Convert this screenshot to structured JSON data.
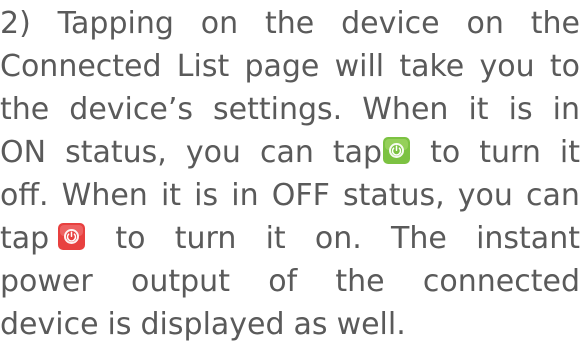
{
  "paragraph": {
    "line1": [
      "2)",
      "Tapping",
      "on",
      "the",
      "device",
      "on",
      "the"
    ],
    "line2": [
      "Connected",
      "List",
      "page",
      "will",
      "take",
      "you",
      "to"
    ],
    "line3": [
      "the",
      "device’s",
      "settings.",
      "When",
      "it",
      "is",
      "in"
    ],
    "line4": {
      "before": [
        "ON",
        "status,",
        "you",
        "can"
      ],
      "tap_icon_prefix": "tap",
      "after": [
        "to",
        "turn",
        "it"
      ]
    },
    "line5": [
      "off.",
      "When",
      "it",
      "is",
      "in",
      "OFF",
      "status,",
      "you",
      "can"
    ],
    "line6": {
      "tap_prefix": "tap",
      "after": [
        "to",
        "turn",
        "it",
        "on.",
        "The",
        "instant"
      ]
    },
    "line7": [
      "power",
      "output",
      "of",
      "the",
      "connected"
    ],
    "line8": [
      "device",
      "is",
      "displayed",
      "as",
      "well."
    ]
  },
  "icons": {
    "on_button": {
      "name": "power-on-icon",
      "color": "#7cc242"
    },
    "off_button": {
      "name": "power-off-icon",
      "color": "#e8403f"
    }
  }
}
